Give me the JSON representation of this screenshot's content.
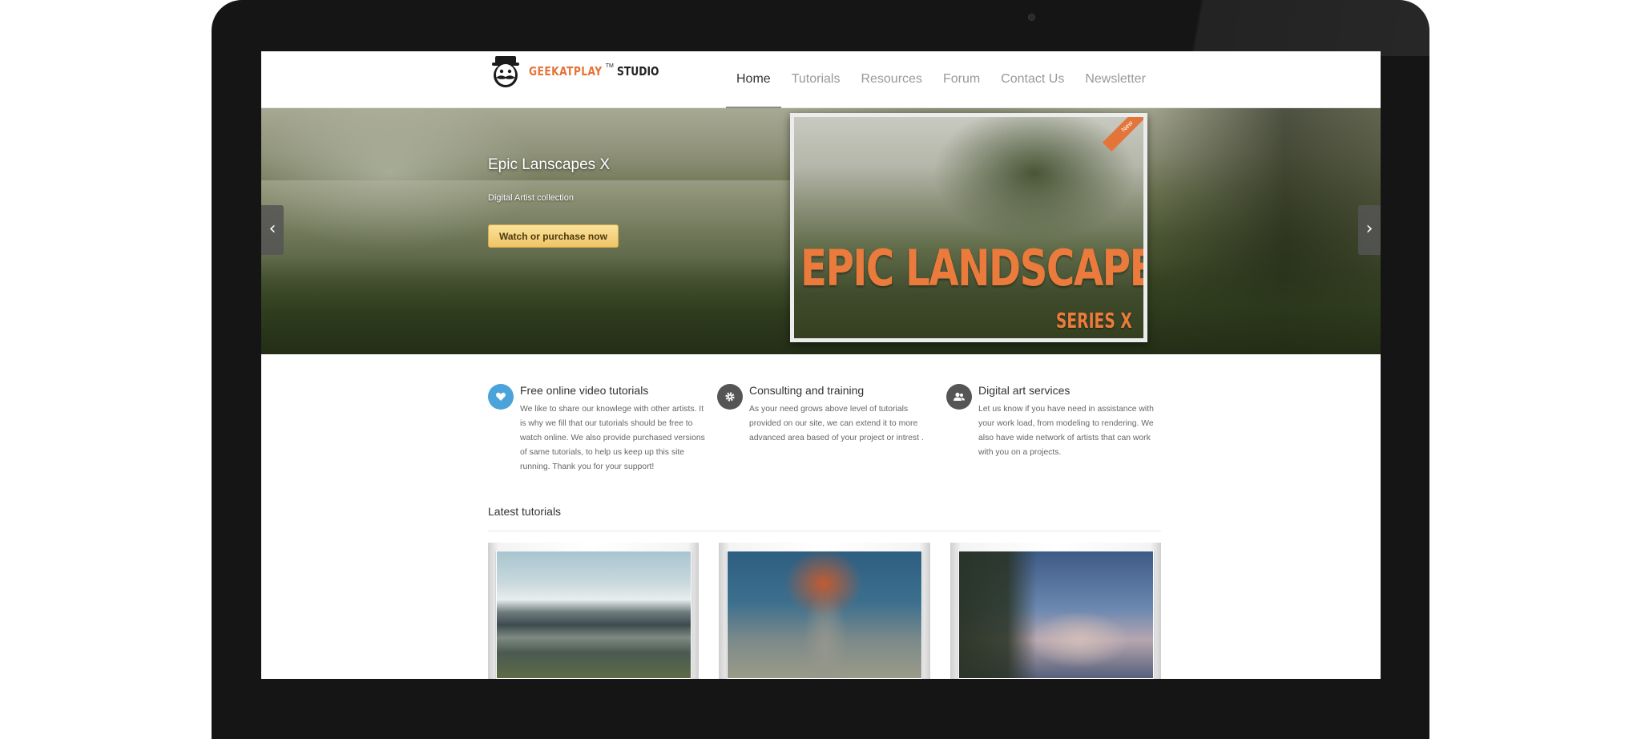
{
  "brand": {
    "name": "GEEKATPLAY",
    "tm": "TM",
    "suffix": "STUDIO"
  },
  "nav": {
    "items": [
      {
        "label": "Home",
        "active": true
      },
      {
        "label": "Tutorials"
      },
      {
        "label": "Resources"
      },
      {
        "label": "Forum"
      },
      {
        "label": "Contact Us"
      },
      {
        "label": "Newsletter"
      }
    ]
  },
  "hero": {
    "title": "Epic Lanscapes X",
    "subtitle": "Digital Artist collection",
    "cta": "Watch or purchase now",
    "product_title": "EPIC LANDSCAPES",
    "product_series": "SERIES X",
    "product_badge": "New",
    "prev_icon": "chevron-left-icon",
    "next_icon": "chevron-right-icon"
  },
  "features": [
    {
      "icon": "heart-icon",
      "icon_color": "#4aa3d9",
      "title": "Free online video tutorials",
      "text": "We like to share our knowlege with other artists. It is why we fill that our tutorials should be free to watch online. We also provide purchased versions of same tutorials, to help us keep up this site running. Thank you for your support!"
    },
    {
      "icon": "gear-icon",
      "icon_color": "#555555",
      "title": "Consulting and training",
      "text": "As your need grows above level of tutorials provided on our site, we can extend it to more advanced area based of your project or intrest ."
    },
    {
      "icon": "users-icon",
      "icon_color": "#555555",
      "title": "Digital art services",
      "text": "Let us know if you have need in assistance with your work load, from modeling to rendering. We also have wide network of artists that can work with you on a projects."
    }
  ],
  "latest": {
    "title": "Latest tutorials"
  },
  "colors": {
    "brand_orange": "#e4753a",
    "cta_gold": "#efc468",
    "nav_active": "#333333",
    "nav_inactive": "#999999"
  }
}
